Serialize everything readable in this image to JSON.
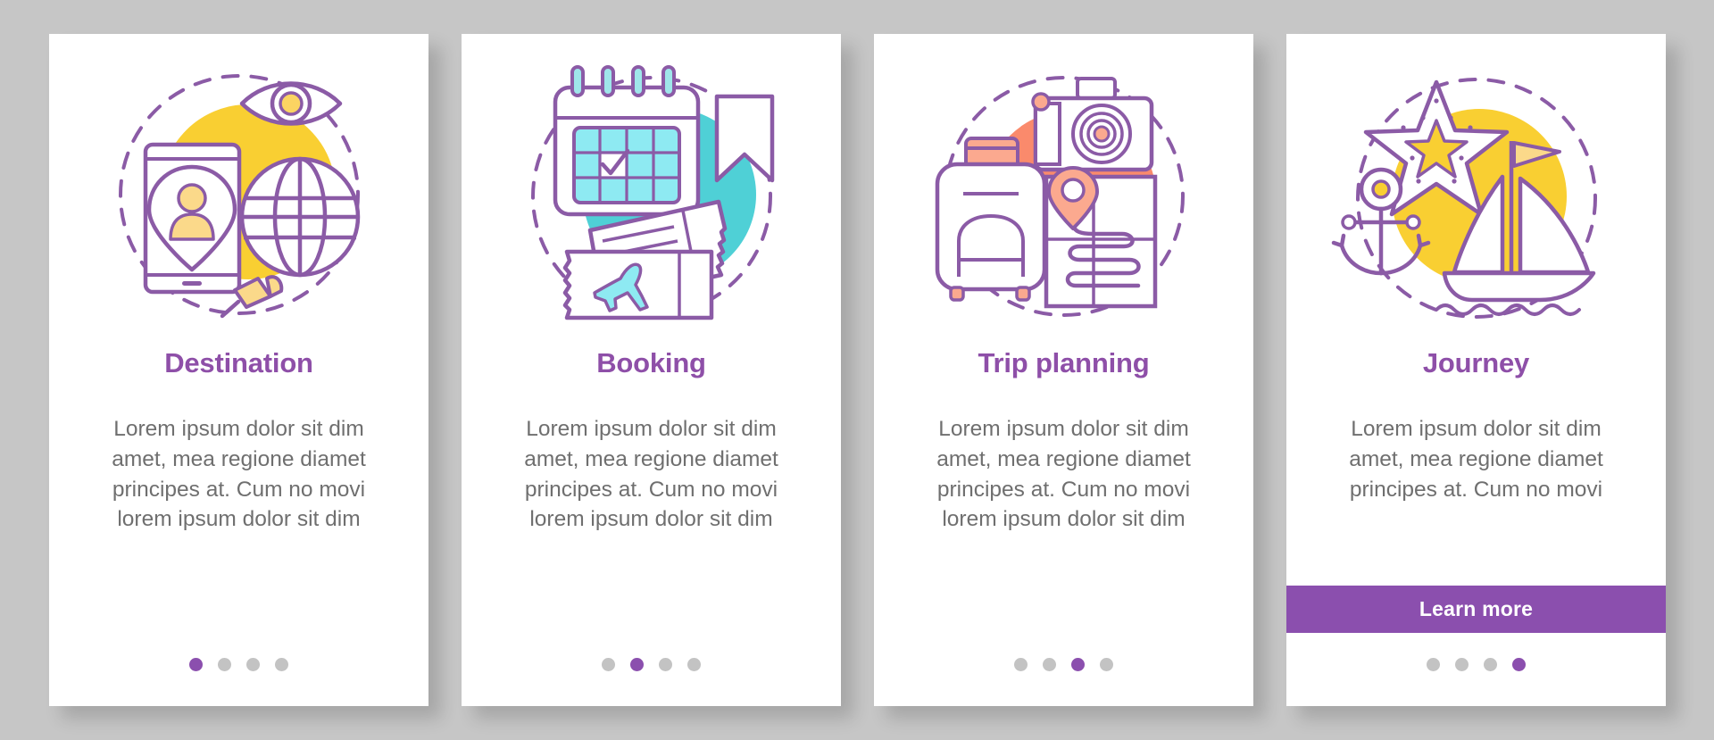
{
  "palette": {
    "background": "#c6c6c6",
    "card_background": "#ffffff",
    "accent_purple": "#8b4fae",
    "title_purple": "#8e4fa8",
    "body_text": "#6f6f6f",
    "dot_inactive": "#c3c3c3",
    "yellow": "#f9cf32",
    "teal": "#4fd0d6",
    "coral": "#fa8a6c",
    "line_purple": "#8b5ba6"
  },
  "screens": [
    {
      "id": "destination",
      "title": "Destination",
      "body": "Lorem ipsum dolor sit dim amet, mea regione diamet principes at. Cum no movi lorem ipsum dolor sit dim",
      "illustration": "destination-illustration",
      "illustration_elements": [
        "smartphone-icon",
        "location-pin-icon",
        "eye-icon",
        "globe-icon",
        "pushpin-icon",
        "yellow-circle",
        "dashed-circle"
      ],
      "accent_shape_color": "#f9cf32",
      "has_button": false,
      "button_label": "",
      "dots": {
        "count": 4,
        "active_index": 0
      }
    },
    {
      "id": "booking",
      "title": "Booking",
      "body": "Lorem ipsum dolor sit dim amet, mea regione diamet principes at. Cum no movi lorem ipsum dolor sit dim",
      "illustration": "booking-illustration",
      "illustration_elements": [
        "calendar-icon",
        "checkmark-icon",
        "bookmark-flag-icon",
        "ticket-icon",
        "airplane-icon",
        "teal-circle",
        "dashed-circle"
      ],
      "accent_shape_color": "#4fd0d6",
      "has_button": false,
      "button_label": "",
      "dots": {
        "count": 4,
        "active_index": 1
      }
    },
    {
      "id": "trip-planning",
      "title": "Trip planning",
      "body": "Lorem ipsum dolor sit dim amet, mea regione diamet principes at. Cum no movi lorem ipsum dolor sit dim",
      "illustration": "trip-planning-illustration",
      "illustration_elements": [
        "suitcase-icon",
        "camera-icon",
        "map-icon",
        "location-pin-icon",
        "coral-circle",
        "dashed-circle"
      ],
      "accent_shape_color": "#fa8a6c",
      "has_button": false,
      "button_label": "",
      "dots": {
        "count": 4,
        "active_index": 2
      }
    },
    {
      "id": "journey",
      "title": "Journey",
      "body": "Lorem ipsum dolor sit dim amet, mea regione diamet principes at. Cum no movi",
      "illustration": "journey-illustration",
      "illustration_elements": [
        "starfish-icon",
        "anchor-icon",
        "sailboat-icon",
        "flag-icon",
        "waves-icon",
        "yellow-circle",
        "dashed-circle"
      ],
      "accent_shape_color": "#f9cf32",
      "has_button": true,
      "button_label": "Learn more",
      "dots": {
        "count": 4,
        "active_index": 3
      }
    }
  ]
}
